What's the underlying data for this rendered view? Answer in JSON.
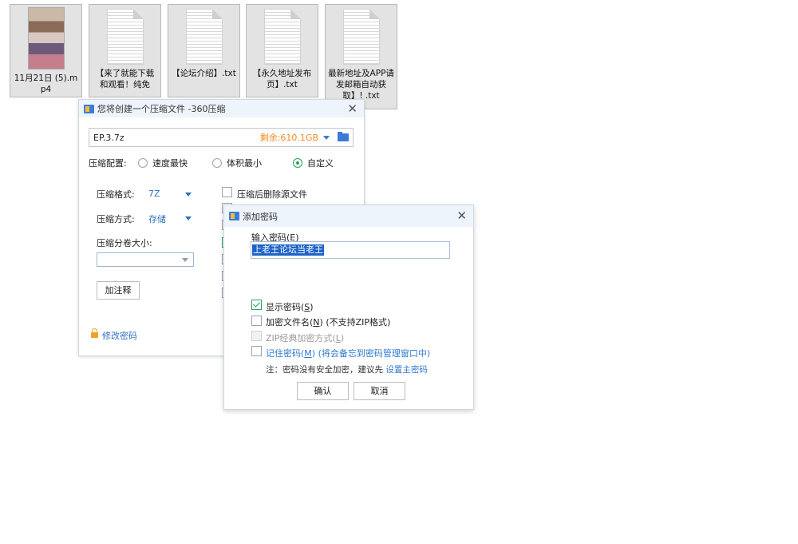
{
  "files": [
    {
      "name": "11月21日 (5).mp4",
      "kind": "video"
    },
    {
      "name": "【来了就能下载和观看！纯免费！】",
      "kind": "txt"
    },
    {
      "name": "【论坛介绍】.txt",
      "kind": "txt"
    },
    {
      "name": "【永久地址发布页】.txt",
      "kind": "txt"
    },
    {
      "name": "最新地址及APP请发邮箱自动获取】! .txt",
      "kind": "txt"
    }
  ],
  "compress_dialog": {
    "title": "您将创建一个压缩文件 -360压缩",
    "archive_name": "EP.3.7z",
    "free_space": "剩余:610.1GB",
    "config_label": "压缩配置:",
    "options": {
      "fastest": "速度最快",
      "smallest": "体积最小",
      "custom": "自定义",
      "selected": "custom"
    },
    "format_label": "压缩格式:",
    "format_value": "7Z",
    "method_label": "压缩方式:",
    "method_value": "存储",
    "split_label": "压缩分卷大小:",
    "split_value": "",
    "comment_button": "加注释",
    "delete_after": "压缩后删除源文件",
    "change_password": "修改密码"
  },
  "password_dialog": {
    "title": "添加密码",
    "input_label": "输入密码(",
    "input_key": "E",
    "input_label_end": ")",
    "password": "上老王论坛当老王",
    "show_password": {
      "label": "显示密码(",
      "key": "S",
      "end": ")",
      "checked": true
    },
    "encrypt_names": {
      "label": "加密文件名(",
      "key": "N",
      "end": ") (不支持ZIP格式)",
      "checked": false
    },
    "zip_classic": {
      "label": "ZIP经典加密方式(",
      "key": "L",
      "end": ")",
      "checked": false,
      "disabled": true
    },
    "remember": {
      "label": "记住密码(",
      "key": "M",
      "end": ") (将会备忘到密码管理窗口中)",
      "checked": false
    },
    "note_prefix": "注：密码没有安全加密，建议先 ",
    "note_link": "设置主密码",
    "ok": "确认",
    "cancel": "取消"
  }
}
